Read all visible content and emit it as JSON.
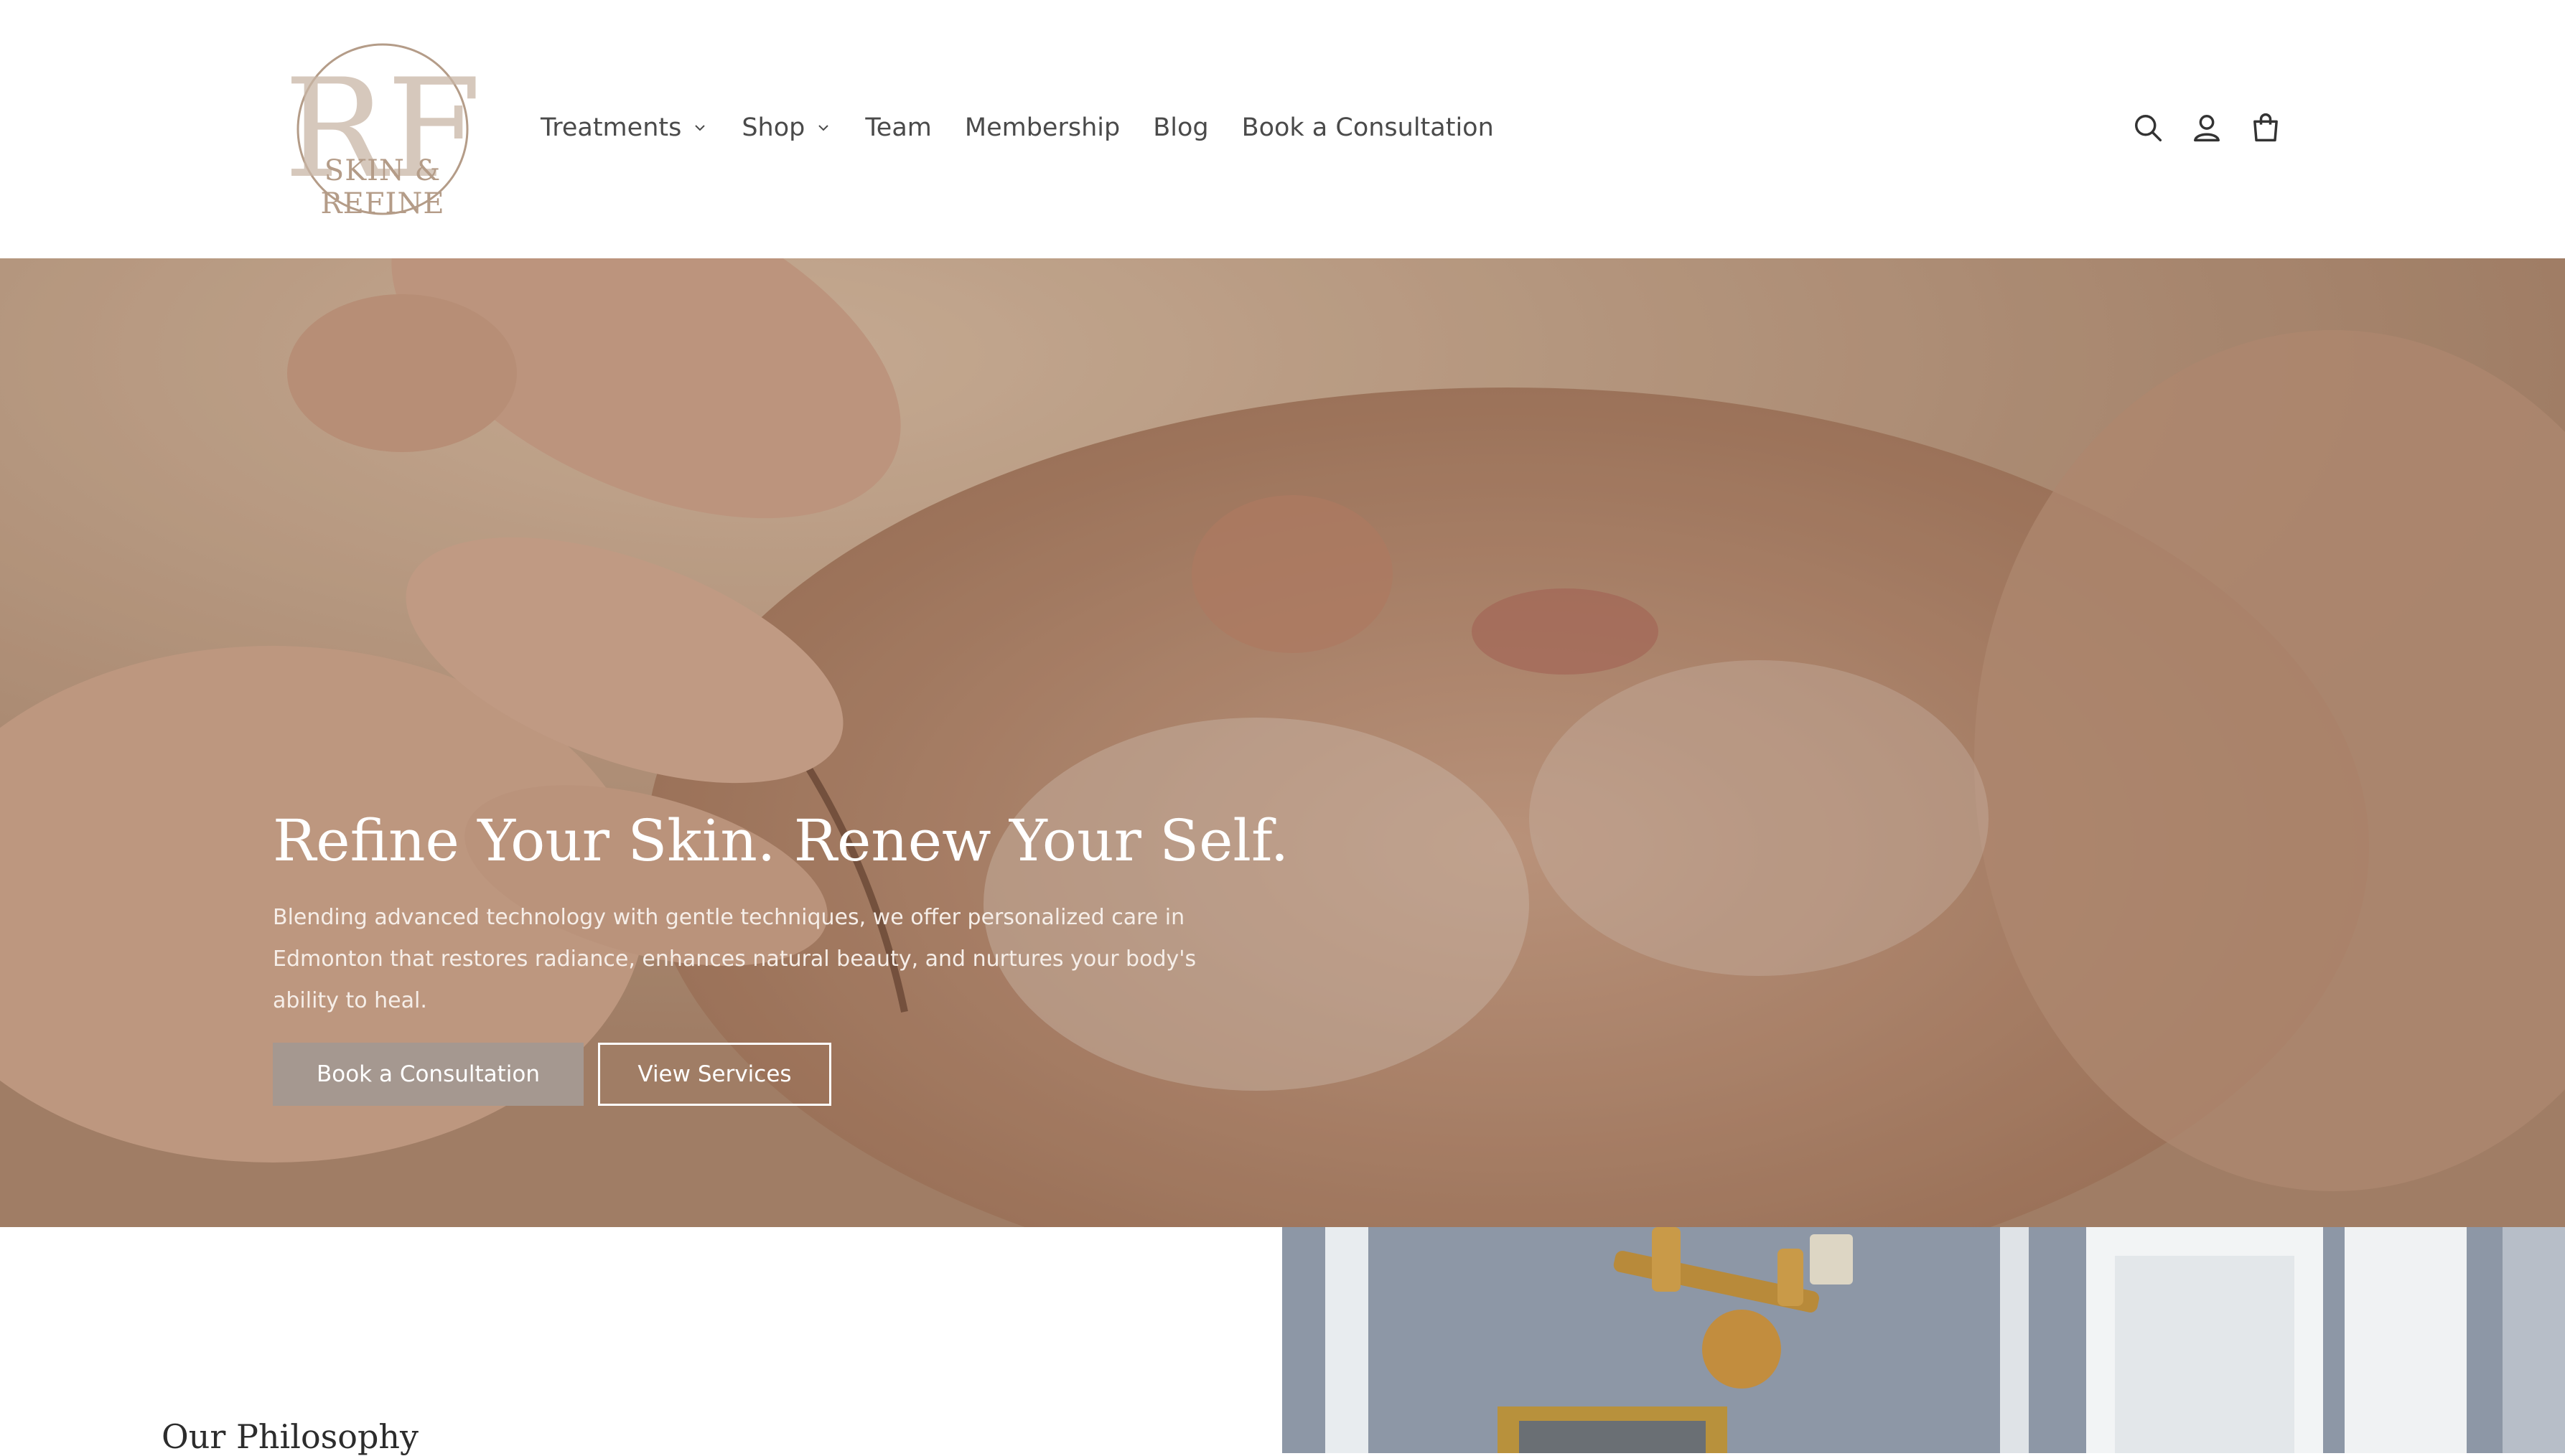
{
  "brand": {
    "logo_monogram": "RF",
    "logo_text": "SKIN & REFINE",
    "logo_color": "#b49c88"
  },
  "nav": {
    "items": [
      {
        "label": "Treatments",
        "has_dropdown": true
      },
      {
        "label": "Shop",
        "has_dropdown": true
      },
      {
        "label": "Team",
        "has_dropdown": false
      },
      {
        "label": "Membership",
        "has_dropdown": false
      },
      {
        "label": "Blog",
        "has_dropdown": false
      },
      {
        "label": "Book a Consultation",
        "has_dropdown": false
      }
    ],
    "icons": [
      "search-icon",
      "account-icon",
      "cart-icon"
    ]
  },
  "hero": {
    "title": "Refine Your Skin. Renew Your Self.",
    "description": "Blending advanced technology with gentle techniques, we offer personalized care in Edmonton that restores radiance, enhances natural beauty, and nurtures your body's ability to heal.",
    "primary_button": "Book a Consultation",
    "secondary_button": "View Services",
    "primary_button_color": "#a59890"
  },
  "philosophy": {
    "title": "Our Philosophy"
  }
}
